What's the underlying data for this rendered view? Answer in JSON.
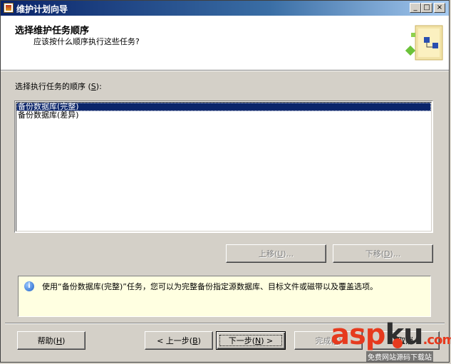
{
  "window": {
    "title": "维护计划向导"
  },
  "header": {
    "title": "选择维护任务顺序",
    "subtitle": "应该按什么顺序执行这些任务?"
  },
  "task_order": {
    "label": "选择执行任务的顺序 (",
    "label_key": "S",
    "label_end": "):",
    "items": [
      {
        "label": "备份数据库(完整)",
        "selected": true
      },
      {
        "label": "备份数据库(差异)",
        "selected": false
      }
    ]
  },
  "move_buttons": {
    "up": {
      "label": "上移(",
      "key": "U",
      "end": ")..."
    },
    "down": {
      "label": "下移(",
      "key": "D",
      "end": ")..."
    }
  },
  "info": {
    "text": "使用“备份数据库(完整)”任务，您可以为完整备份指定源数据库、目标文件或磁带以及覆盖选项。"
  },
  "footer": {
    "help": {
      "label": "帮助(",
      "key": "H",
      "end": ")"
    },
    "back": {
      "label": "< 上一步(",
      "key": "B",
      "end": ")"
    },
    "next": {
      "label": "下一步(",
      "key": "N",
      "end": ") >"
    },
    "finish": {
      "label": "完成(",
      "key": "F",
      "end": ")"
    },
    "cancel": {
      "label": "取消"
    }
  },
  "watermark": {
    "main": "asp",
    "main2": "ku",
    "suffix": ".com",
    "sub": "免费网站源码下载站"
  }
}
